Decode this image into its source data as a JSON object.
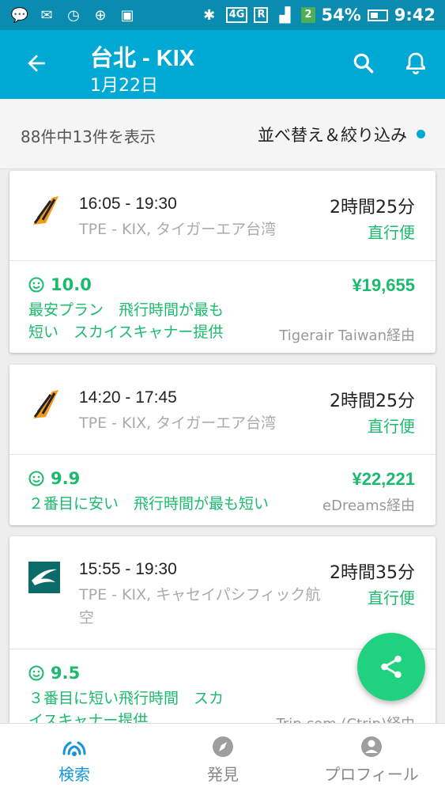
{
  "status_bar": {
    "network": "4G",
    "roaming": "R",
    "sim_badge": "2",
    "battery": "54%",
    "time": "9:42"
  },
  "header": {
    "title": "台北 - KIX",
    "date": "1月22日",
    "back_icon": "arrow-left-icon",
    "search_icon": "search-icon",
    "bell_icon": "bell-icon"
  },
  "summary": {
    "result_count": "88件中13件を表示",
    "sort_filter_label": "並べ替え＆絞り込み"
  },
  "flights": [
    {
      "times": "16:05 - 19:30",
      "route": "TPE - KIX, タイガーエア台湾",
      "duration": "2時間25分",
      "direct": "直行便",
      "score": "10.0",
      "price": "¥19,655",
      "tags_line1": "最安プラン　飛行時間が最も",
      "tags_line2": "短い　スカイスキャナー提供",
      "via": "Tigerair Taiwan経由"
    },
    {
      "times": "14:20 - 17:45",
      "route": "TPE - KIX, タイガーエア台湾",
      "duration": "2時間25分",
      "direct": "直行便",
      "score": "9.9",
      "price": "¥22,221",
      "tags_line1": "２番目に安い　飛行時間が最も短い",
      "via": "eDreams経由"
    },
    {
      "times": "15:55 - 19:30",
      "route_line1": "TPE - KIX, キャセイパシフィック航",
      "route_line2": "空",
      "duration": "2時間35分",
      "direct": "直行便",
      "score": "9.5",
      "price": "¥",
      "tags_line1": "３番目に短い飛行時間　スカ",
      "tags_line2": "イスキャナー提供",
      "via": "Trip.com (Ctrip)経由"
    }
  ],
  "bottom_nav": [
    {
      "label": "検索",
      "icon": "skyscanner-icon"
    },
    {
      "label": "発見",
      "icon": "compass-icon"
    },
    {
      "label": "プロフィール",
      "icon": "profile-icon"
    }
  ],
  "colors": {
    "status_bar": "#0a8cb0",
    "app_bar": "#00a9d4",
    "green": "#1bba6e",
    "fab": "#20d280",
    "nav_active": "#1596d6"
  }
}
